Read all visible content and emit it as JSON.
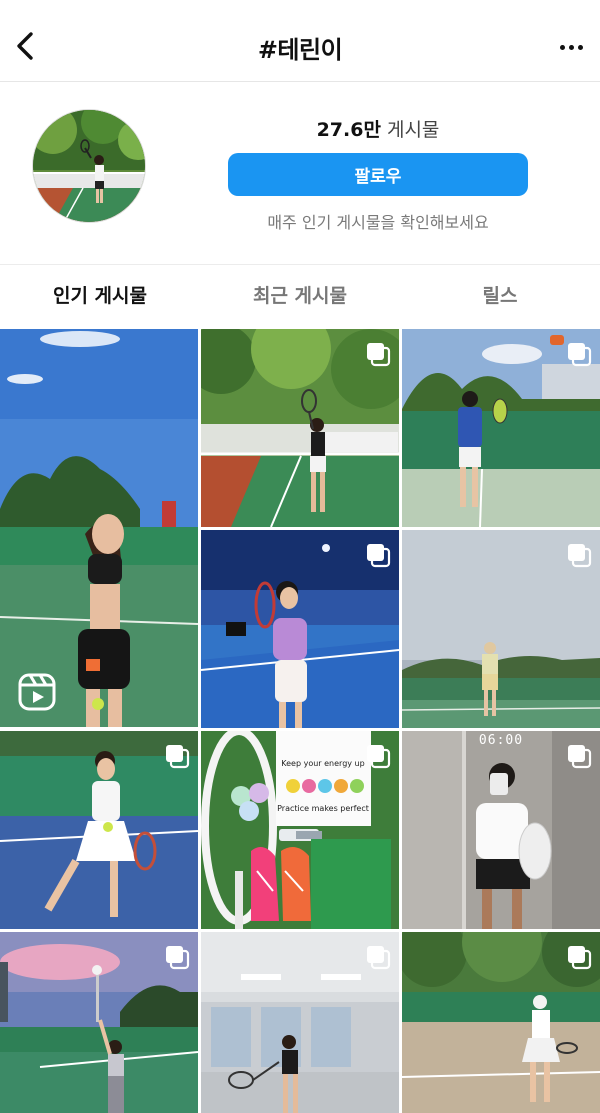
{
  "header": {
    "title": "#테린이",
    "back_icon": "chevron-left-icon",
    "more_icon": "more-horizontal-icon"
  },
  "profile": {
    "post_count": "27.6만",
    "post_count_label": "게시물",
    "follow_label": "팔로우",
    "hint": "매주 인기 게시물을 확인해보세요"
  },
  "tabs": [
    {
      "label": "인기 게시물",
      "active": true
    },
    {
      "label": "최근 게시물",
      "active": false
    },
    {
      "label": "릴스",
      "active": false
    }
  ],
  "posts": [
    {
      "type": "reel",
      "icon": "reels-icon"
    },
    {
      "type": "carousel",
      "icon": "multiple-photos-icon"
    },
    {
      "type": "carousel",
      "icon": "multiple-photos-icon"
    },
    {
      "type": "carousel",
      "icon": "multiple-photos-icon"
    },
    {
      "type": "carousel",
      "icon": "multiple-photos-icon"
    },
    {
      "type": "carousel",
      "icon": "multiple-photos-icon"
    },
    {
      "type": "carousel",
      "icon": "multiple-photos-icon"
    },
    {
      "type": "carousel",
      "icon": "multiple-photos-icon",
      "overlay_time": "06:00"
    },
    {
      "type": "carousel",
      "icon": "multiple-photos-icon"
    },
    {
      "type": "carousel",
      "icon": "multiple-photos-icon"
    },
    {
      "type": "carousel",
      "icon": "multiple-photos-icon"
    }
  ],
  "shirt_text": {
    "line1": "Keep your energy up",
    "line2": "Practice makes perfect"
  },
  "colors": {
    "accent": "#1a95f2",
    "court_green": "#3f8a5c",
    "court_blue": "#2f63b8"
  }
}
